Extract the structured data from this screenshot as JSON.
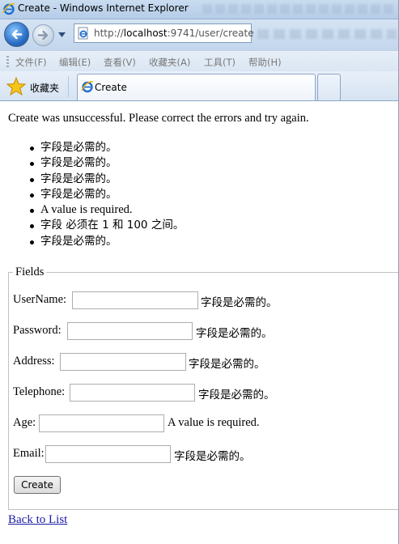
{
  "window": {
    "title": "Create - Windows Internet Explorer"
  },
  "nav": {
    "url_prefix": "http://",
    "url_host": "localhost",
    "url_rest": ":9741/user/create"
  },
  "menu": {
    "items": [
      "文件(F)",
      "编辑(E)",
      "查看(V)",
      "收藏夹(A)",
      "工具(T)",
      "帮助(H)"
    ]
  },
  "tabs": {
    "favorites_label": "收藏夹",
    "active_tab_label": "Create"
  },
  "page": {
    "validation_summary": "Create was unsuccessful. Please correct the errors and try again.",
    "errors": [
      "字段是必需的。",
      "字段是必需的。",
      "字段是必需的。",
      "字段是必需的。",
      "A value is required.",
      "字段 必须在 1 和 100 之间。",
      "字段是必需的。"
    ],
    "fieldset_legend": "Fields",
    "fields": [
      {
        "label": "UserName:",
        "value": "",
        "error": "字段是必需的。"
      },
      {
        "label": "Password:",
        "value": "",
        "error": "字段是必需的。"
      },
      {
        "label": "Address:",
        "value": "",
        "error": "字段是必需的。"
      },
      {
        "label": "Telephone:",
        "value": "",
        "error": "字段是必需的。"
      },
      {
        "label": "Age:",
        "value": "",
        "error": "A value is required."
      },
      {
        "label": "Email:",
        "value": "",
        "error": "字段是必需的。"
      }
    ],
    "create_button": "Create",
    "back_link": "Back to List"
  },
  "colors": {
    "link": "#1a1aa6",
    "chrome_blue": "#c9dcf0"
  },
  "icons": {
    "back": "back-arrow-icon",
    "forward": "forward-arrow-icon",
    "ie": "ie-logo-icon",
    "favorites": "star-icon"
  }
}
